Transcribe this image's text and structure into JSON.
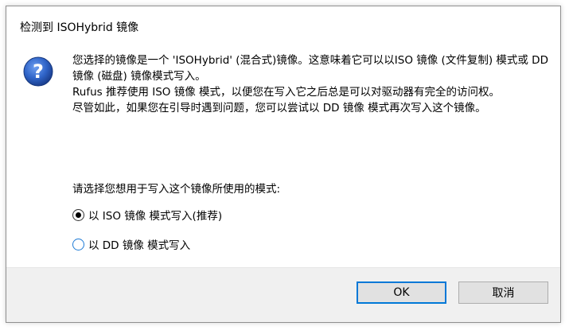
{
  "dialog": {
    "title": "检测到 ISOHybrid 镜像",
    "icon": "question-icon",
    "message_lines": [
      "您选择的镜像是一个 'ISOHybrid' (混合式)镜像。这意味着它可以以ISO 镜像 (文件复制) 模式或 DD 镜像 (磁盘) 镜像模式写入。",
      "Rufus 推荐使用 ISO 镜像 模式，以便您在写入它之后总是可以对驱动器有完全的访问权。",
      "尽管如此，如果您在引导时遇到问题，您可以尝试以 DD 镜像 模式再次写入这个镜像。"
    ],
    "prompt": "请选择您想用于写入这个镜像所使用的模式:",
    "options": [
      {
        "label": "以 ISO 镜像 模式写入(推荐)",
        "selected": true
      },
      {
        "label": "以 DD 镜像 模式写入",
        "selected": false
      }
    ],
    "buttons": {
      "ok": "OK",
      "cancel": "取消"
    },
    "colors": {
      "icon_blue": "#2f64c8",
      "focus_border": "#0078d7",
      "footer_bg": "#f0f0f0"
    }
  }
}
